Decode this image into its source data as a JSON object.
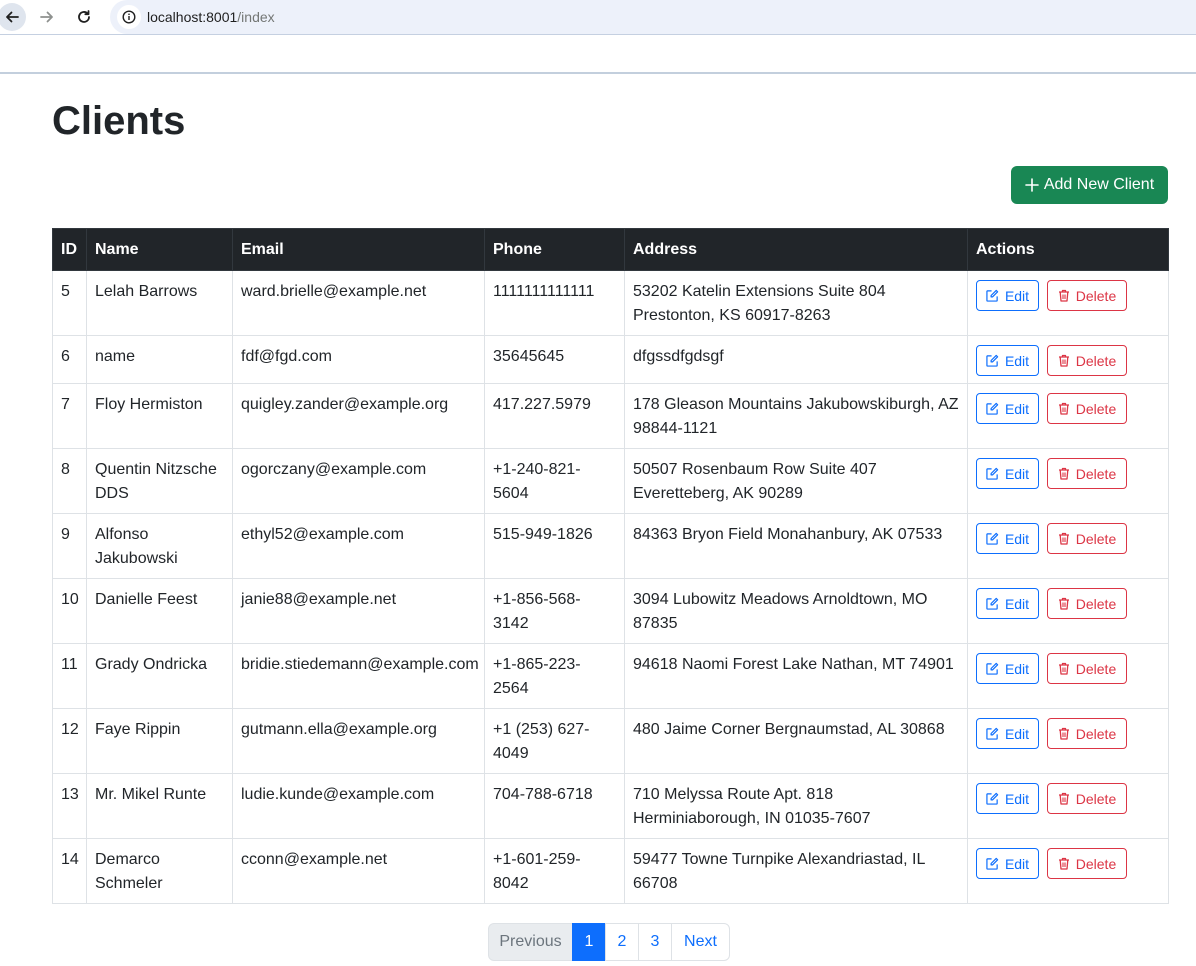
{
  "browser": {
    "url_host": "localhost:8001",
    "url_path": "/index"
  },
  "page": {
    "title": "Clients",
    "add_button_label": "Add New Client"
  },
  "table": {
    "columns": [
      "ID",
      "Name",
      "Email",
      "Phone",
      "Address",
      "Actions"
    ],
    "edit_label": "Edit",
    "delete_label": "Delete",
    "rows": [
      {
        "id": "5",
        "name": "Lelah Barrows",
        "email": "ward.brielle@example.net",
        "phone": "1111111111111",
        "address": "53202 Katelin Extensions Suite 804 Prestonton, KS 60917-8263"
      },
      {
        "id": "6",
        "name": "name",
        "email": "fdf@fgd.com",
        "phone": "35645645",
        "address": "dfgssdfgdsgf"
      },
      {
        "id": "7",
        "name": "Floy Hermiston",
        "email": "quigley.zander@example.org",
        "phone": "417.227.5979",
        "address": "178 Gleason Mountains Jakubowskiburgh, AZ 98844-1121"
      },
      {
        "id": "8",
        "name": "Quentin Nitzsche DDS",
        "email": "ogorczany@example.com",
        "phone": "+1-240-821-5604",
        "address": "50507 Rosenbaum Row Suite 407 Everetteberg, AK 90289"
      },
      {
        "id": "9",
        "name": "Alfonso Jakubowski",
        "email": "ethyl52@example.com",
        "phone": "515-949-1826",
        "address": "84363 Bryon Field Monahanbury, AK 07533"
      },
      {
        "id": "10",
        "name": "Danielle Feest",
        "email": "janie88@example.net",
        "phone": "+1-856-568-3142",
        "address": "3094 Lubowitz Meadows Arnoldtown, MO 87835"
      },
      {
        "id": "11",
        "name": "Grady Ondricka",
        "email": "bridie.stiedemann@example.com",
        "phone": "+1-865-223-2564",
        "address": "94618 Naomi Forest Lake Nathan, MT 74901"
      },
      {
        "id": "12",
        "name": "Faye Rippin",
        "email": "gutmann.ella@example.org",
        "phone": "+1 (253) 627-4049",
        "address": "480 Jaime Corner Bergnaumstad, AL 30868"
      },
      {
        "id": "13",
        "name": "Mr. Mikel Runte",
        "email": "ludie.kunde@example.com",
        "phone": "704-788-6718",
        "address": "710 Melyssa Route Apt. 818 Herminiaborough, IN 01035-7607"
      },
      {
        "id": "14",
        "name": "Demarco Schmeler",
        "email": "cconn@example.net",
        "phone": "+1-601-259-8042",
        "address": "59477 Towne Turnpike Alexandriastad, IL 66708"
      }
    ]
  },
  "pagination": {
    "previous": "Previous",
    "pages": [
      "1",
      "2",
      "3"
    ],
    "active_page": "1",
    "next": "Next"
  },
  "colors": {
    "success": "#198754",
    "primary": "#0d6efd",
    "danger": "#dc3545",
    "table_header": "#212529"
  }
}
